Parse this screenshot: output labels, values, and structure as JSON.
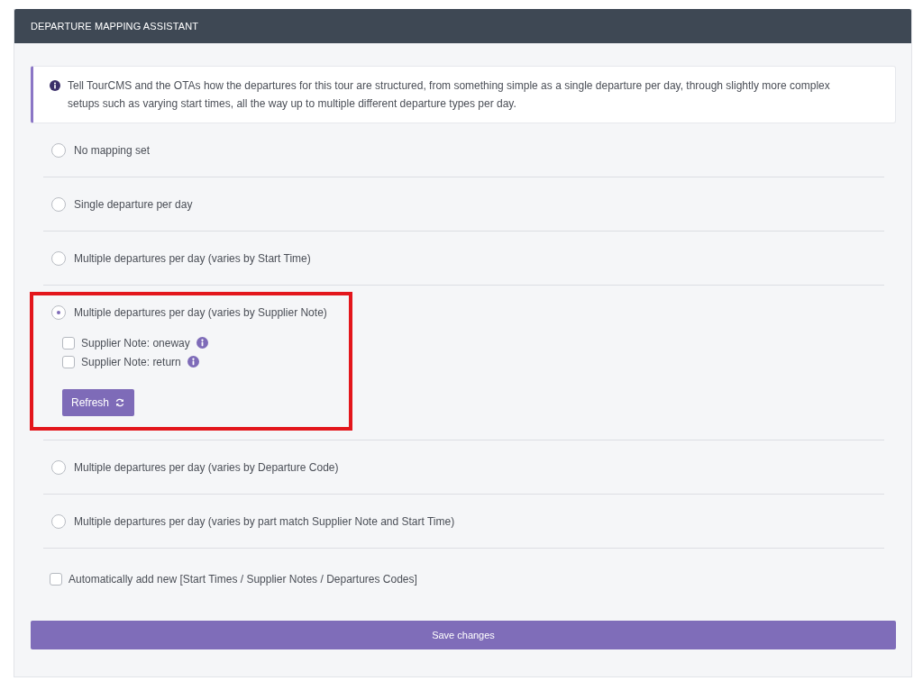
{
  "panel": {
    "title": "DEPARTURE MAPPING ASSISTANT"
  },
  "info": {
    "text": "Tell TourCMS and the OTAs how the departures for this tour are structured, from something simple as a single departure per day, through slightly more complex setups such as varying start times, all the way up to multiple different departure types per day."
  },
  "options": [
    {
      "label": "No mapping set",
      "selected": false,
      "highlighted": false
    },
    {
      "label": "Single departure per day",
      "selected": false,
      "highlighted": false
    },
    {
      "label": "Multiple departures per day (varies by Start Time)",
      "selected": false,
      "highlighted": false
    },
    {
      "label": "Multiple departures per day (varies by Supplier Note)",
      "selected": true,
      "highlighted": true,
      "sub_options": [
        {
          "label": "Supplier Note: oneway",
          "checked": false
        },
        {
          "label": "Supplier Note: return",
          "checked": false
        }
      ],
      "refresh_button": "Refresh"
    },
    {
      "label": "Multiple departures per day (varies by Departure Code)",
      "selected": false,
      "highlighted": false
    },
    {
      "label": "Multiple departures per day (varies by part match Supplier Note and Start Time)",
      "selected": false,
      "highlighted": false
    }
  ],
  "auto_add": {
    "label": "Automatically add new [Start Times / Supplier Notes / Departures Codes]",
    "checked": false
  },
  "save_button": "Save changes"
}
